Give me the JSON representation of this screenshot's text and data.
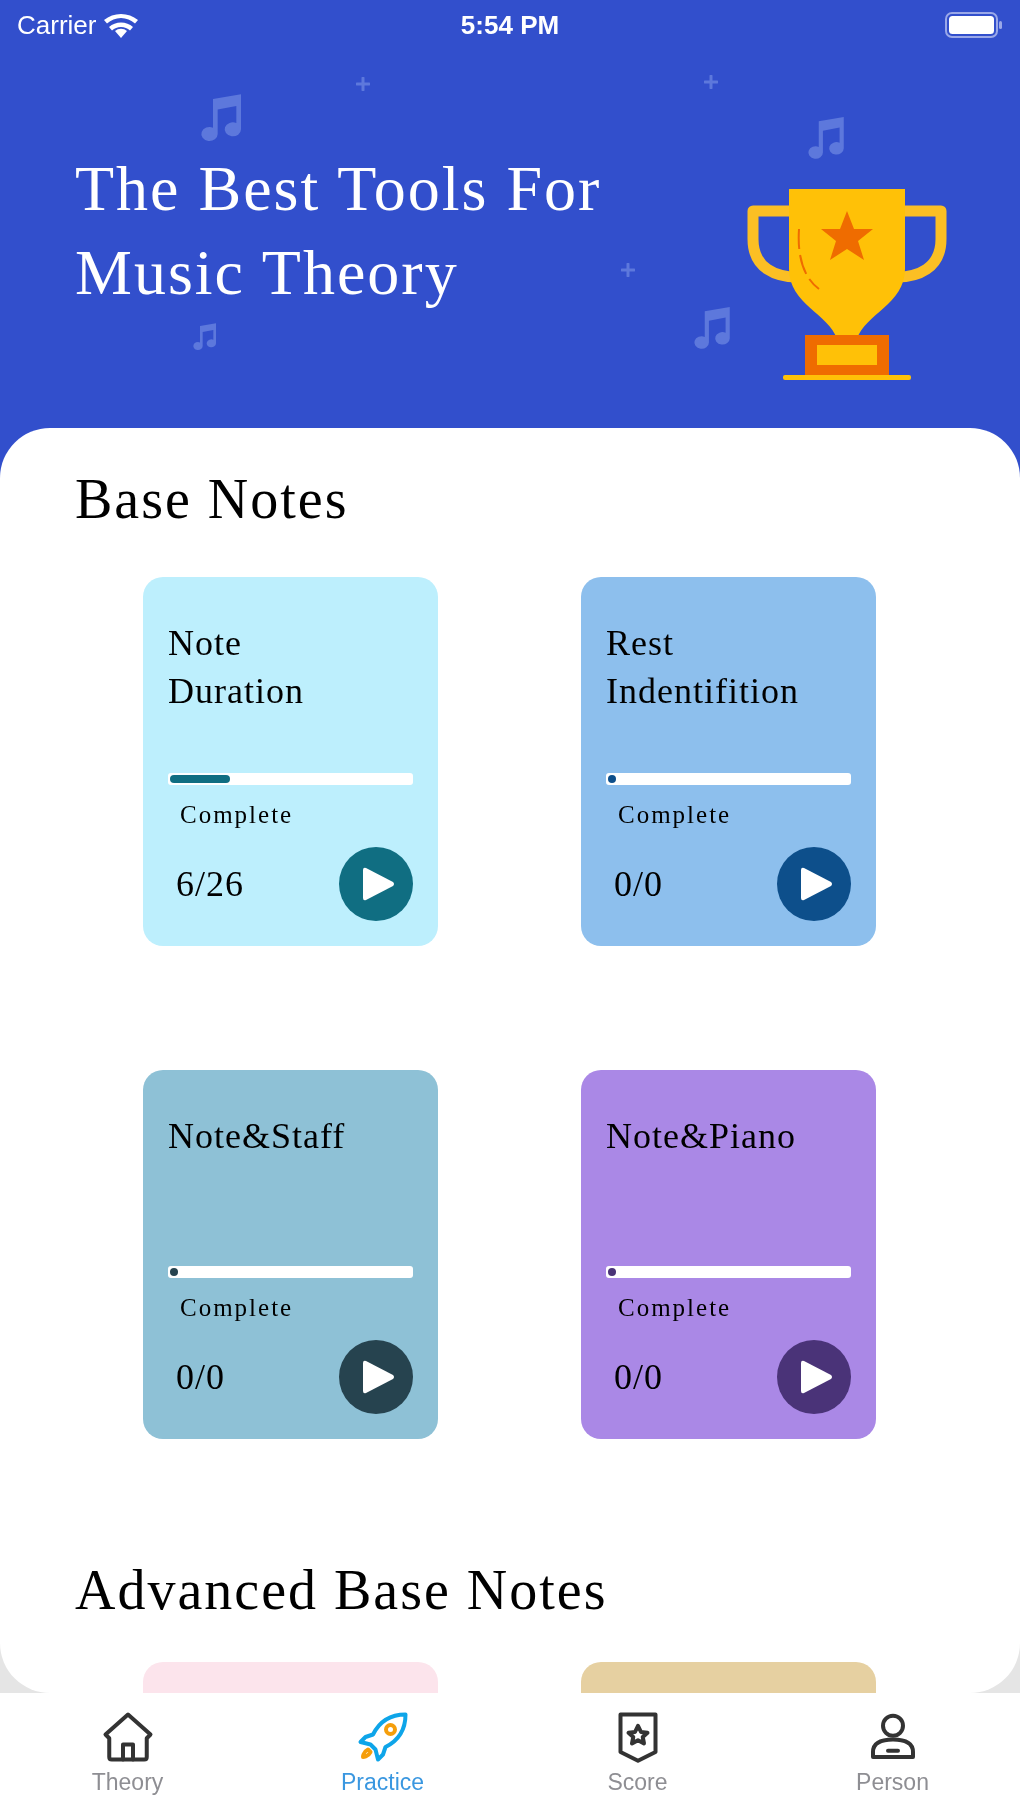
{
  "status_bar": {
    "carrier": "Carrier",
    "time": "5:54 PM"
  },
  "header": {
    "title_lines": [
      "The Best Tools For",
      "Music Theory"
    ]
  },
  "sections": [
    {
      "title": "Base Notes",
      "cards": [
        {
          "title_lines": [
            "Note",
            "Duration"
          ],
          "progress_label": "Complete",
          "count": "6/26",
          "level": 0.25,
          "color": "#bdeffd",
          "play_button": {
            "color": "#106e82"
          }
        },
        {
          "title_lines": [
            "Rest",
            "Indentifition"
          ],
          "progress_label": "Complete",
          "count": "0/0",
          "level": 0,
          "color": "#8dbfed",
          "play_button": {
            "color": "#0d4f8b"
          }
        },
        {
          "title_lines": [
            "Note&Staff"
          ],
          "progress_label": "Complete",
          "count": "0/0",
          "level": 0,
          "color": "#8ec1d6",
          "play_button": {
            "color": "#26434f"
          }
        },
        {
          "title_lines": [
            "Note&Piano"
          ],
          "progress_label": "Complete",
          "count": "0/0",
          "level": 0,
          "color": "#aa88e6",
          "play_button": {
            "color": "#4a3378"
          }
        }
      ]
    },
    {
      "title": "Advanced Base Notes",
      "cards": [
        {
          "color": "#fce4ec"
        },
        {
          "color": "#e6d0a1"
        }
      ]
    }
  ],
  "tabs": [
    {
      "label": "Theory",
      "kind": "home",
      "selected": false
    },
    {
      "label": "Practice",
      "kind": "rocket",
      "selected": true
    },
    {
      "label": "Score",
      "kind": "badge",
      "selected": false
    },
    {
      "label": "Person",
      "kind": "person",
      "selected": false
    }
  ]
}
